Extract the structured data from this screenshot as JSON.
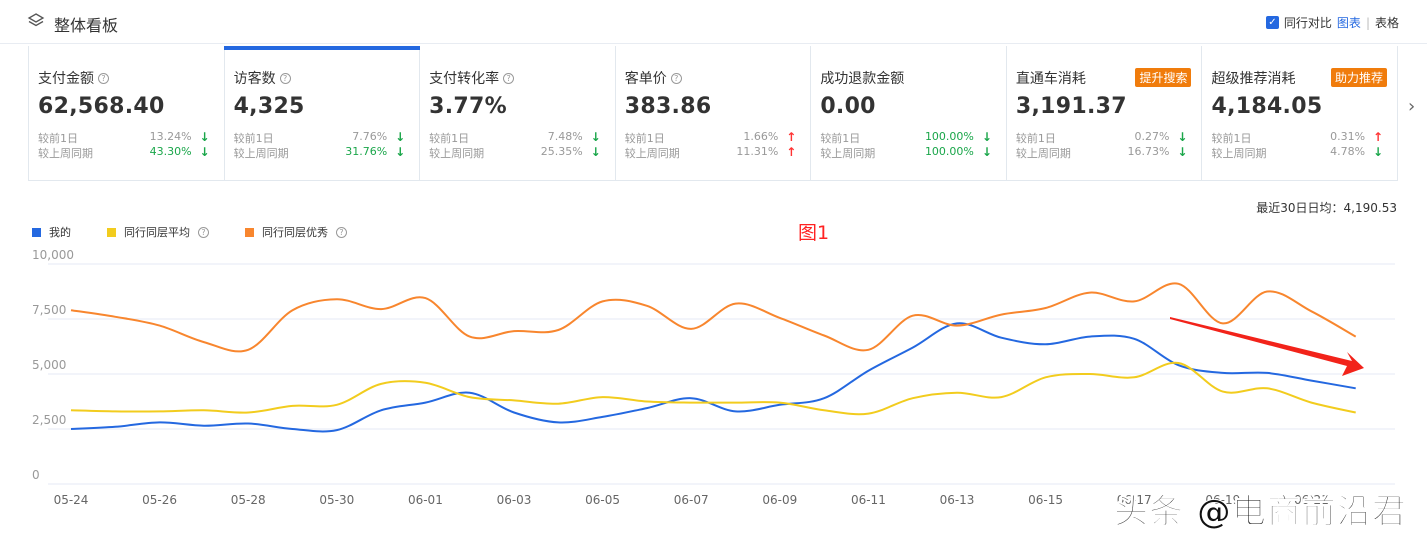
{
  "header": {
    "title": "整体看板",
    "icon": "layers-icon",
    "compare_label": "同行对比",
    "compare_checked": true,
    "view_chart": "图表",
    "view_sep": "|",
    "view_table": "表格"
  },
  "cards": [
    {
      "name": "支付金额",
      "help": true,
      "value": "62,568.40",
      "rows": [
        {
          "label": "较前1日",
          "value": "13.24%",
          "dir": "down",
          "highlight": false
        },
        {
          "label": "较上周同期",
          "value": "43.30%",
          "dir": "down",
          "highlight": true
        }
      ]
    },
    {
      "name": "访客数",
      "help": true,
      "selected": true,
      "value": "4,325",
      "rows": [
        {
          "label": "较前1日",
          "value": "7.76%",
          "dir": "down",
          "highlight": false
        },
        {
          "label": "较上周同期",
          "value": "31.76%",
          "dir": "down",
          "highlight": true
        }
      ]
    },
    {
      "name": "支付转化率",
      "help": true,
      "value": "3.77%",
      "rows": [
        {
          "label": "较前1日",
          "value": "7.48%",
          "dir": "down",
          "highlight": false
        },
        {
          "label": "较上周同期",
          "value": "25.35%",
          "dir": "down",
          "highlight": false
        }
      ]
    },
    {
      "name": "客单价",
      "help": true,
      "value": "383.86",
      "rows": [
        {
          "label": "较前1日",
          "value": "1.66%",
          "dir": "up",
          "highlight": false
        },
        {
          "label": "较上周同期",
          "value": "11.31%",
          "dir": "up",
          "highlight": false
        }
      ]
    },
    {
      "name": "成功退款金额",
      "help": false,
      "value": "0.00",
      "rows": [
        {
          "label": "较前1日",
          "value": "100.00%",
          "dir": "down",
          "highlight": true
        },
        {
          "label": "较上周同期",
          "value": "100.00%",
          "dir": "down",
          "highlight": true
        }
      ]
    },
    {
      "name": "直通车消耗",
      "help": false,
      "badge": "提升搜索",
      "value": "3,191.37",
      "rows": [
        {
          "label": "较前1日",
          "value": "0.27%",
          "dir": "down",
          "highlight": false
        },
        {
          "label": "较上周同期",
          "value": "16.73%",
          "dir": "down",
          "highlight": false
        }
      ]
    },
    {
      "name": "超级推荐消耗",
      "help": false,
      "badge": "助力推荐",
      "value": "4,184.05",
      "rows": [
        {
          "label": "较前1日",
          "value": "0.31%",
          "dir": "up",
          "highlight": false
        },
        {
          "label": "较上周同期",
          "value": "4.78%",
          "dir": "down",
          "highlight": false
        }
      ]
    }
  ],
  "colors": {
    "accent": "#2468e0",
    "up": "#f33",
    "down": "#1aa64a",
    "badge": "#f07c0c"
  },
  "summary": "最近30日日均：4,190.53",
  "annotation": "图1",
  "watermark": "头条 @电商前沿君",
  "chart_data": {
    "type": "line",
    "ylim": [
      0,
      10000
    ],
    "yticks": [
      "0",
      "2,500",
      "5,000",
      "7,500",
      "10,000"
    ],
    "grid": true,
    "legend": "top-left",
    "x": [
      "05-24",
      "05-25",
      "05-26",
      "05-27",
      "05-28",
      "05-29",
      "05-30",
      "05-31",
      "06-01",
      "06-02",
      "06-03",
      "06-04",
      "06-05",
      "06-06",
      "06-07",
      "06-08",
      "06-09",
      "06-10",
      "06-11",
      "06-12",
      "06-13",
      "06-14",
      "06-15",
      "06-16",
      "06-17",
      "06-18",
      "06-19",
      "06-20",
      "06-21",
      "06-22"
    ],
    "xticks": [
      "05-24",
      "05-26",
      "05-28",
      "05-30",
      "06-01",
      "06-03",
      "06-05",
      "06-07",
      "06-09",
      "06-11",
      "06-13",
      "06-15",
      "06-17",
      "06-19",
      "06-21"
    ],
    "series": [
      {
        "name": "我的",
        "color": "#2468e0",
        "values": [
          2500,
          2600,
          2800,
          2650,
          2750,
          2500,
          2450,
          3350,
          3700,
          4150,
          3250,
          2800,
          3050,
          3450,
          3900,
          3300,
          3600,
          3900,
          5150,
          6200,
          7300,
          6650,
          6350,
          6700,
          6600,
          5400,
          5050,
          5050,
          4700,
          4350
        ]
      },
      {
        "name": "同行同层平均",
        "help": true,
        "color": "#f2cc1e",
        "values": [
          3350,
          3300,
          3300,
          3350,
          3250,
          3550,
          3600,
          4550,
          4600,
          3950,
          3800,
          3650,
          3950,
          3750,
          3700,
          3700,
          3700,
          3350,
          3200,
          3900,
          4150,
          3950,
          4850,
          5000,
          4850,
          5500,
          4200,
          4350,
          3700,
          3250
        ]
      },
      {
        "name": "同行同层优秀",
        "help": true,
        "color": "#f8862e",
        "values": [
          7900,
          7600,
          7200,
          6450,
          6100,
          7900,
          8400,
          7950,
          8450,
          6700,
          6950,
          7000,
          8300,
          8100,
          7050,
          8200,
          7550,
          6750,
          6100,
          7650,
          7200,
          7700,
          8000,
          8700,
          8300,
          9100,
          7300,
          8750,
          7850,
          6700
        ]
      }
    ]
  }
}
